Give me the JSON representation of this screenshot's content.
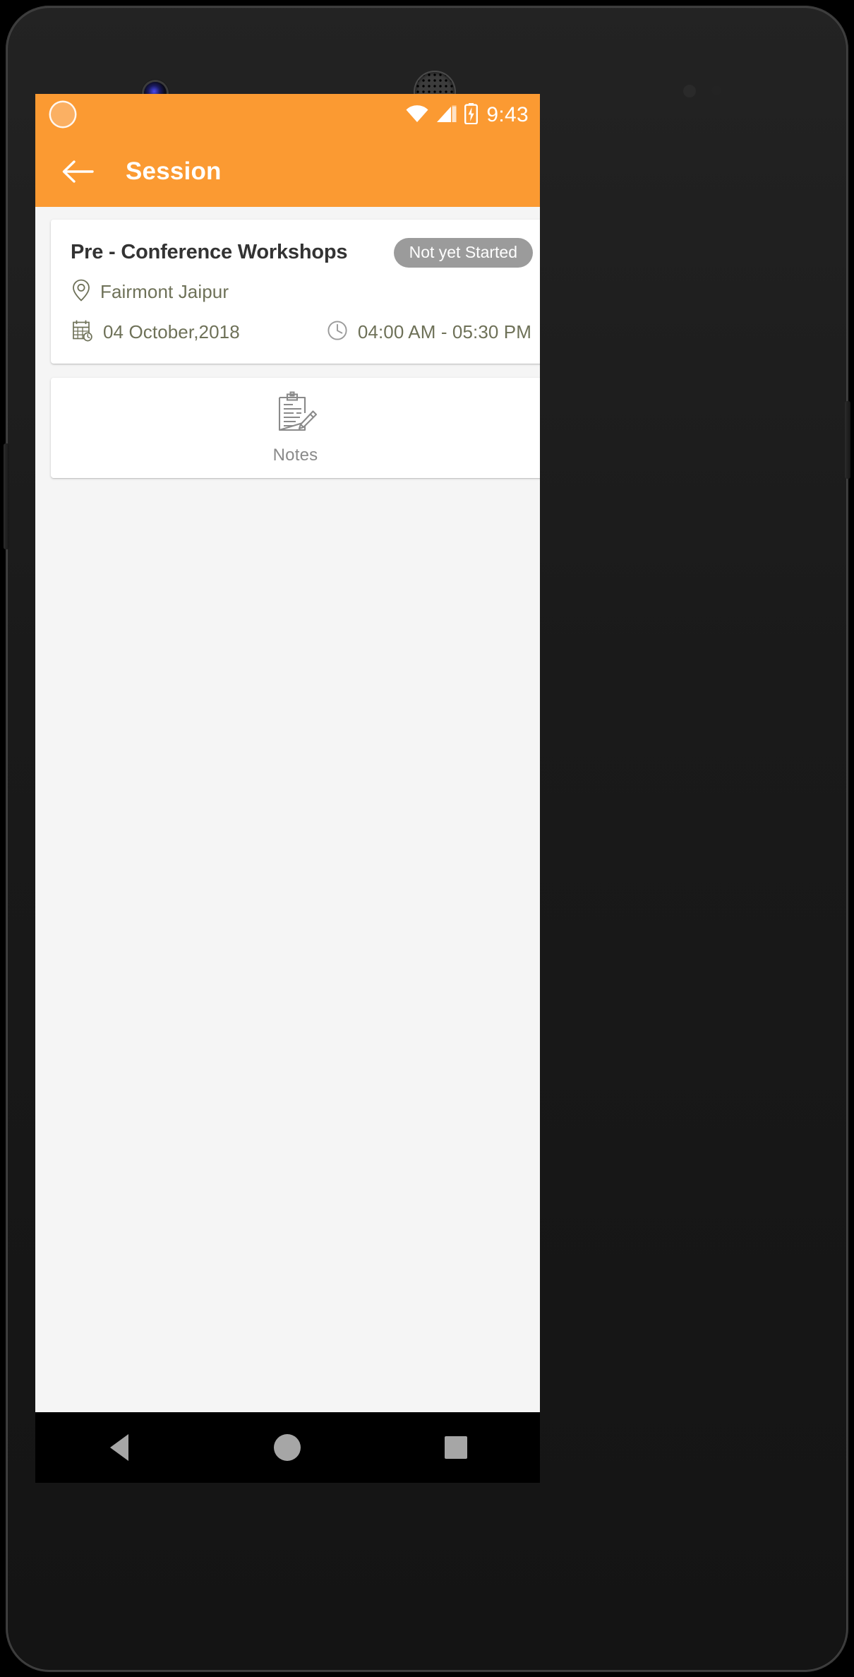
{
  "device": {
    "camera_icon": "front-camera-icon",
    "speaker_icon": "earpiece-speaker-icon"
  },
  "status_bar": {
    "wifi_icon": "wifi-icon",
    "signal_icon": "cellular-signal-icon",
    "battery_icon": "battery-charging-icon",
    "time": "9:43"
  },
  "toolbar": {
    "back_icon": "arrow-left-icon",
    "title": "Session",
    "background_color": "#fb9a32"
  },
  "session_card": {
    "title": "Pre - Conference Workshops",
    "status_badge": "Not yet Started",
    "status_badge_color": "#9b9b9b",
    "location_icon": "map-pin-icon",
    "location": "Fairmont Jaipur",
    "date_icon": "calendar-clock-icon",
    "date": "04 October,2018",
    "time_icon": "clock-icon",
    "time_range": "04:00 AM - 05:30 PM",
    "detail_text_color": "#6e7158"
  },
  "notes_card": {
    "icon": "clipboard-pencil-icon",
    "label": "Notes"
  },
  "nav_bar": {
    "back_icon": "nav-back-triangle-icon",
    "home_icon": "nav-home-circle-icon",
    "recents_icon": "nav-recents-square-icon"
  }
}
